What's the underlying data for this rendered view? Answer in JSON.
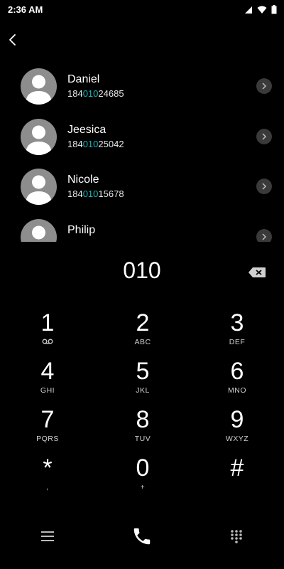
{
  "status_bar": {
    "time": "2:36 AM"
  },
  "contacts": [
    {
      "name": "Daniel",
      "number_pre": "184",
      "number_hl": "010",
      "number_post": "24685"
    },
    {
      "name": "Jeesica",
      "number_pre": "184",
      "number_hl": "010",
      "number_post": "25042"
    },
    {
      "name": "Nicole",
      "number_pre": "184",
      "number_hl": "010",
      "number_post": "15678"
    },
    {
      "name": "Philip",
      "number_pre": "",
      "number_hl": "",
      "number_post": ""
    }
  ],
  "dialed_number": "010",
  "keypad": [
    {
      "digit": "1",
      "letters": ""
    },
    {
      "digit": "2",
      "letters": "ABC"
    },
    {
      "digit": "3",
      "letters": "DEF"
    },
    {
      "digit": "4",
      "letters": "GHI"
    },
    {
      "digit": "5",
      "letters": "JKL"
    },
    {
      "digit": "6",
      "letters": "MNO"
    },
    {
      "digit": "7",
      "letters": "PQRS"
    },
    {
      "digit": "8",
      "letters": "TUV"
    },
    {
      "digit": "9",
      "letters": "WXYZ"
    },
    {
      "digit": "*",
      "letters": ","
    },
    {
      "digit": "0",
      "letters": "+"
    },
    {
      "digit": "#",
      "letters": ""
    }
  ],
  "icons": {
    "back": "chevron-left-icon",
    "backspace": "backspace-icon",
    "voicemail": "voicemail-icon",
    "menu": "menu-icon",
    "call": "phone-icon",
    "dialpad": "dialpad-icon"
  },
  "colors": {
    "highlight": "#19b5b5",
    "background": "#000000"
  }
}
